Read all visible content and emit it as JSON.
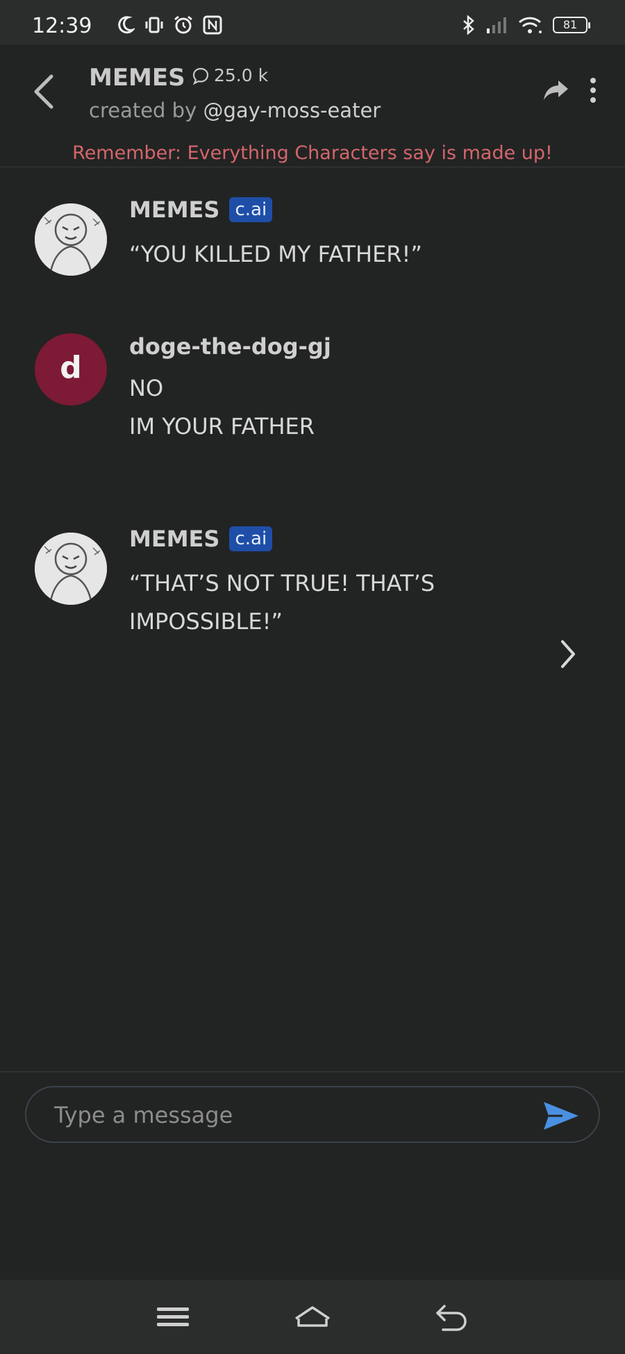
{
  "status_bar": {
    "time": "12:39",
    "battery": "81"
  },
  "header": {
    "title": "MEMES",
    "chat_count": "25.0 k",
    "created_by_prefix": "created by ",
    "creator_handle": "@gay-moss-eater",
    "disclaimer": "Remember: Everything Characters say is made up!"
  },
  "messages": [
    {
      "author": "MEMES",
      "badge": "c.ai",
      "avatar": "character-sketch-image",
      "lines": [
        "“YOU KILLED MY FATHER!”"
      ]
    },
    {
      "author": "doge-the-dog-gj",
      "avatar_letter": "d",
      "lines": [
        "NO",
        "IM YOUR FATHER"
      ]
    },
    {
      "author": "MEMES",
      "badge": "c.ai",
      "avatar": "character-sketch-image",
      "lines": [
        "“THAT’S NOT TRUE! THAT’S",
        "IMPOSSIBLE!”"
      ]
    }
  ],
  "composer": {
    "placeholder": "Type a message"
  },
  "colors": {
    "background": "#222423",
    "disclaimer": "#d3666c",
    "badge": "#1e4ea8",
    "user_avatar": "#7d1a35",
    "send": "#4a90e2"
  }
}
